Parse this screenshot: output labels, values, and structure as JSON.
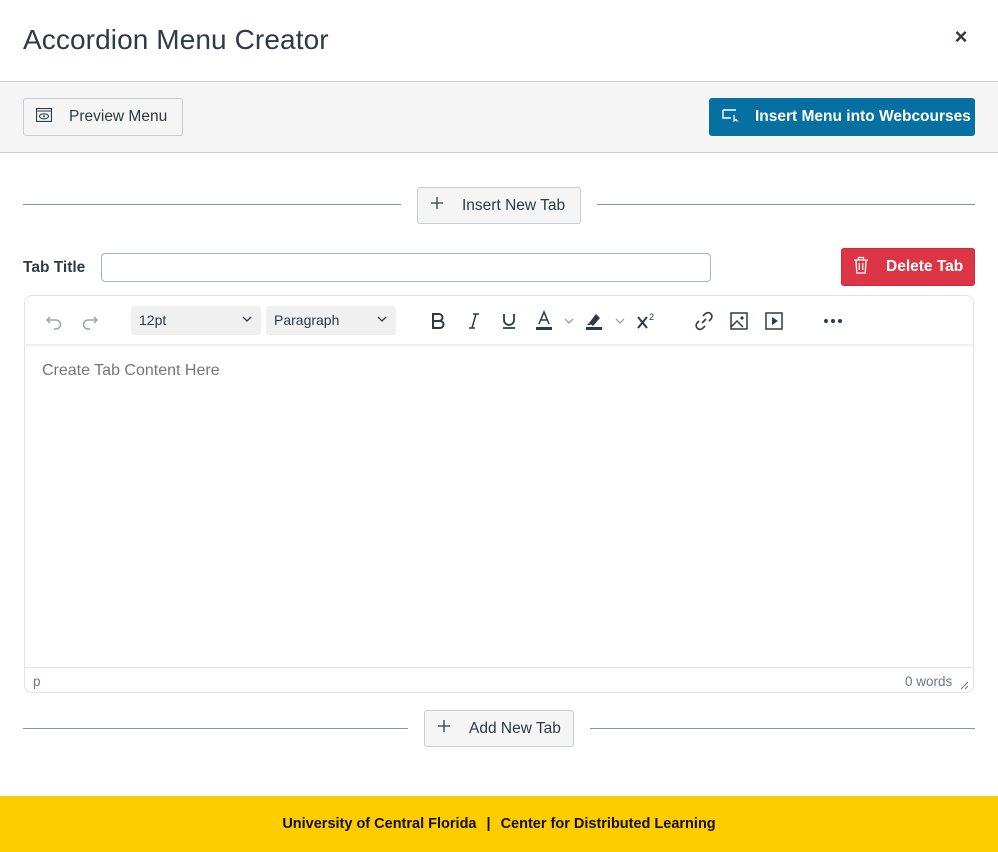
{
  "header": {
    "title": "Accordion Menu Creator",
    "close": "×"
  },
  "toolbar": {
    "preview_label": "Preview Menu",
    "insert_web_label": "Insert Menu into Webcourses"
  },
  "tabs": {
    "insert_new_tab": "Insert New Tab",
    "add_new_tab": "Add New Tab"
  },
  "tab": {
    "title_label": "Tab Title",
    "title_value": "",
    "delete_label": "Delete Tab"
  },
  "editor": {
    "font_size": "12pt",
    "block_format": "Paragraph",
    "placeholder": "Create Tab Content Here",
    "path": "p",
    "word_count": "0 words"
  },
  "footer": {
    "left": "University of Central Florida",
    "separator": "|",
    "right": "Center for Distributed Learning"
  },
  "colors": {
    "primary": "#0770a3",
    "danger": "#dc3545",
    "footer_bg": "#ffcc00"
  }
}
